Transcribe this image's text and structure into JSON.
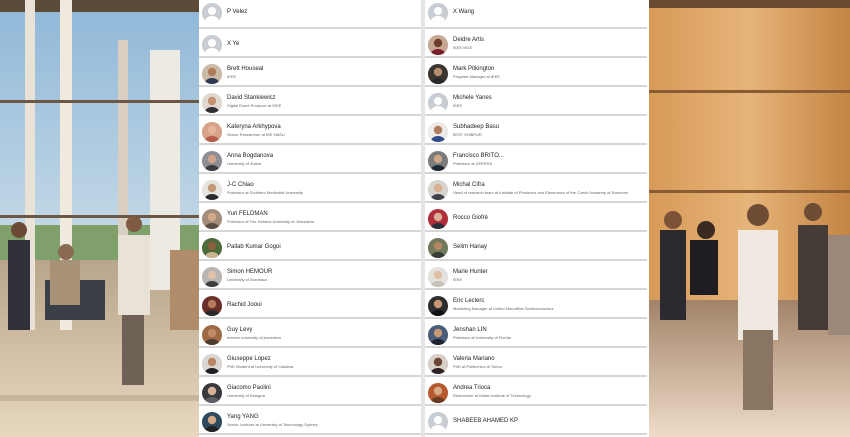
{
  "attendees_left": [
    {
      "name": "P Velez",
      "subtitle": "",
      "avatar": "default"
    },
    {
      "name": "X Ye",
      "subtitle": "",
      "avatar": "default"
    },
    {
      "name": "Brett Houseal",
      "subtitle": "IEEE",
      "avatar": "photo"
    },
    {
      "name": "David Stankiewicz",
      "subtitle": "Digital Event Producer at IEEE",
      "avatar": "photo"
    },
    {
      "name": "Kateryna Arkhypova",
      "subtitle": "Senior Researcher at IRE NASU",
      "avatar": "photo"
    },
    {
      "name": "Anna Bogdanova",
      "subtitle": "University of Zurich",
      "avatar": "photo"
    },
    {
      "name": "J-C Chiao",
      "subtitle": "Professor at Southern Methodist University",
      "avatar": "photo"
    },
    {
      "name": "Yuri FELDMAN",
      "subtitle": "Professor at The Hebrew University of Jerusalem",
      "avatar": "photo"
    },
    {
      "name": "Pallab Kumar Gogoi",
      "subtitle": "",
      "avatar": "photo"
    },
    {
      "name": "Simon HEMOUR",
      "subtitle": "University of Bordeaux",
      "avatar": "photo"
    },
    {
      "name": "Rachid Jooui",
      "subtitle": "",
      "avatar": "photo"
    },
    {
      "name": "Guy Levy",
      "subtitle": "hebrew university of jerusalem",
      "avatar": "photo"
    },
    {
      "name": "Giuseppe Lopez",
      "subtitle": "PhD Student at University of Calabria",
      "avatar": "photo"
    },
    {
      "name": "Giacomo Paolini",
      "subtitle": "University of Bologna",
      "avatar": "photo"
    },
    {
      "name": "Yang YANG",
      "subtitle": "Senior Lecturer at University of Technology Sydney",
      "avatar": "photo"
    }
  ],
  "attendees_right": [
    {
      "name": "X Wang",
      "subtitle": "",
      "avatar": "default"
    },
    {
      "name": "Deidre Artis",
      "subtitle": "IEEE MCE",
      "avatar": "photo"
    },
    {
      "name": "Mark Pitkington",
      "subtitle": "Program Manager at IEEE",
      "avatar": "photo"
    },
    {
      "name": "Michele Yanes",
      "subtitle": "IEEE",
      "avatar": "default"
    },
    {
      "name": "Subhadeep Basu",
      "subtitle": "IIEST SHIBPUR",
      "avatar": "photo"
    },
    {
      "name": "Francisco BRITO...",
      "subtitle": "Professor at UPERSA",
      "avatar": "photo"
    },
    {
      "name": "Michal Cifra",
      "subtitle": "Head of research team at Institute of Photonics and Electronics of the Czech Academy of Sciences",
      "avatar": "photo"
    },
    {
      "name": "Rocco Giofrè",
      "subtitle": "",
      "avatar": "photo"
    },
    {
      "name": "Selim Hanay",
      "subtitle": "",
      "avatar": "photo"
    },
    {
      "name": "Marie Hunter",
      "subtitle": "IEEE",
      "avatar": "photo"
    },
    {
      "name": "Eric Leclerc",
      "subtitle": "Marketing Manager at United Monolithic Semiconductors",
      "avatar": "photo"
    },
    {
      "name": "Jenshan LIN",
      "subtitle": "Professor at University of Florida",
      "avatar": "photo"
    },
    {
      "name": "Valeria Mariano",
      "subtitle": "PhD at Politecnico di Torino",
      "avatar": "photo"
    },
    {
      "name": "Andrea Trioca",
      "subtitle": "Researcher at Italian Institute of Technology",
      "avatar": "photo"
    },
    {
      "name": "SHABEEB AHAMED KP",
      "subtitle": "",
      "avatar": "default"
    }
  ]
}
